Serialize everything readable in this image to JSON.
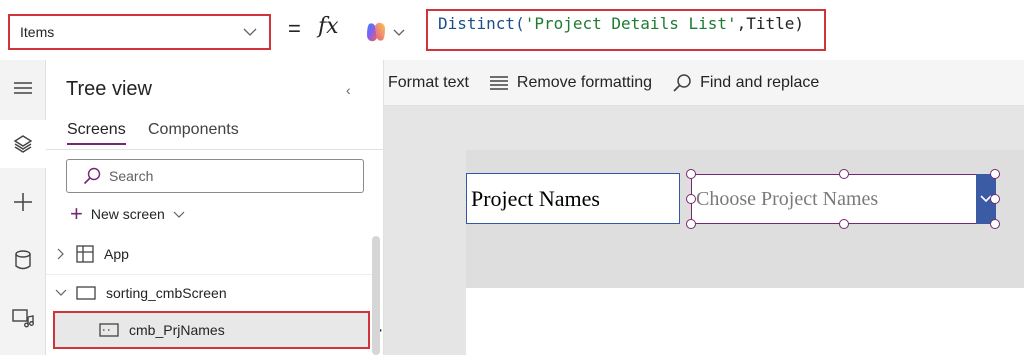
{
  "formula_bar": {
    "property": "Items",
    "equals": "=",
    "fx": "fx",
    "formula": {
      "fn": "Distinct(",
      "arg": "'Project Details List'",
      "rest": ",Title)"
    }
  },
  "toolbar": {
    "format_text": "Format text",
    "remove_formatting": "Remove formatting",
    "find_replace": "Find and replace"
  },
  "tree": {
    "title": "Tree view",
    "collapse": "‹",
    "tabs": [
      "Screens",
      "Components"
    ],
    "search_placeholder": "Search",
    "new_screen": "New screen",
    "items": {
      "app": "App",
      "screen": "sorting_cmbScreen",
      "control": "cmb_PrjNames"
    },
    "more": "···"
  },
  "canvas": {
    "label_text": "Project Names",
    "combo_placeholder": "Choose Project Names"
  },
  "colors": {
    "accent": "#742774",
    "highlight": "#d13438",
    "combo_button": "#3b5ba5"
  },
  "icons": {
    "rail": [
      "hamburger-icon",
      "layers-icon",
      "plus-icon",
      "database-icon",
      "media-icon"
    ]
  }
}
